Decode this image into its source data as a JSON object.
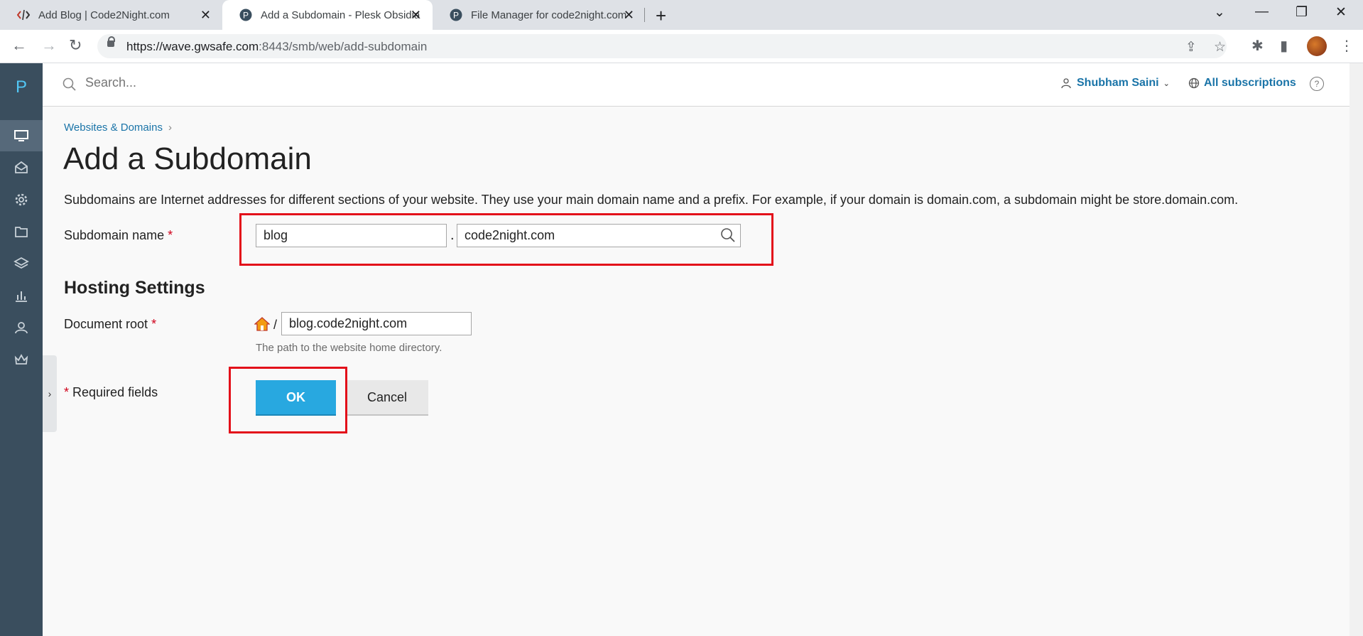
{
  "browser": {
    "tabs": [
      {
        "title": "Add Blog | Code2Night.com",
        "icon": "code-icon"
      },
      {
        "title": "Add a Subdomain - Plesk Obsidian",
        "icon": "plesk-icon"
      },
      {
        "title": "File Manager for code2night.com",
        "icon": "plesk-icon"
      }
    ],
    "url_host": "https://wave.gwsafe.com",
    "url_path": ":8443/smb/web/add-subdomain"
  },
  "plesk": {
    "logo": "P",
    "nav": [
      "websites-domains",
      "mail",
      "applications",
      "files",
      "databases",
      "statistics",
      "users",
      "account"
    ],
    "search_placeholder": "Search...",
    "user": "Shubham Saini",
    "subscriptions": "All subscriptions"
  },
  "page": {
    "breadcrumb": "Websites & Domains",
    "title": "Add a Subdomain",
    "description": "Subdomains are Internet addresses for different sections of your website. They use your main domain name and a prefix. For example, if your domain is domain.com, a subdomain might be store.domain.com.",
    "subdomain_label": "Subdomain name",
    "subdomain_value": "blog",
    "domain_value": "code2night.com",
    "separator": ".",
    "hosting_section": "Hosting Settings",
    "docroot_label": "Document root",
    "docroot_slash": "/",
    "docroot_value": "blog.code2night.com",
    "docroot_hint": "The path to the website home directory.",
    "required_marker": "*",
    "required_text": "Required fields",
    "ok_label": "OK",
    "cancel_label": "Cancel"
  },
  "colors": {
    "accent": "#28a8e0",
    "link": "#1a74a8",
    "highlight": "#e3101a",
    "sidebar": "#3a4e5e"
  }
}
